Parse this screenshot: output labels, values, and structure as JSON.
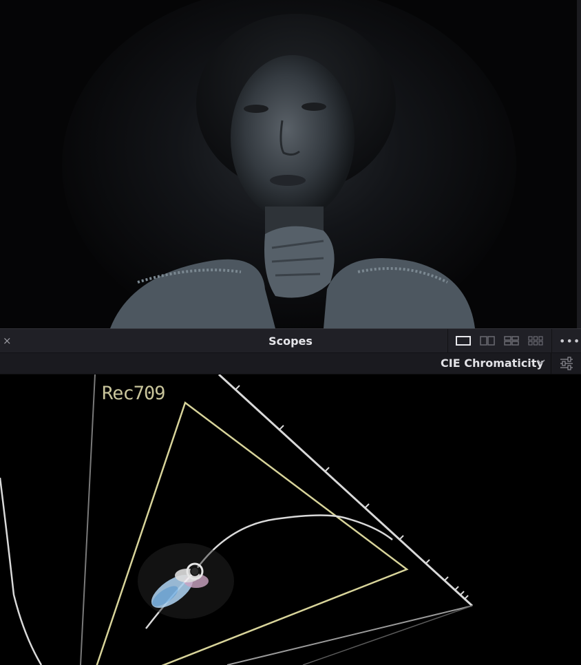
{
  "viewer": {
    "subject_description": ""
  },
  "panel": {
    "title": "Scopes",
    "close_icon": "×",
    "layout_buttons": [
      "single-layout-icon",
      "dual-layout-icon",
      "quad-layout-icon",
      "six-layout-icon"
    ],
    "more_label": "•••"
  },
  "scope_selector": {
    "value": "CIE Chromaticity"
  },
  "scope": {
    "gamut_label": "Rec709",
    "colors": {
      "gamut": "#d8d49a",
      "locus": "#d9d9d9",
      "background": "#000000"
    }
  }
}
